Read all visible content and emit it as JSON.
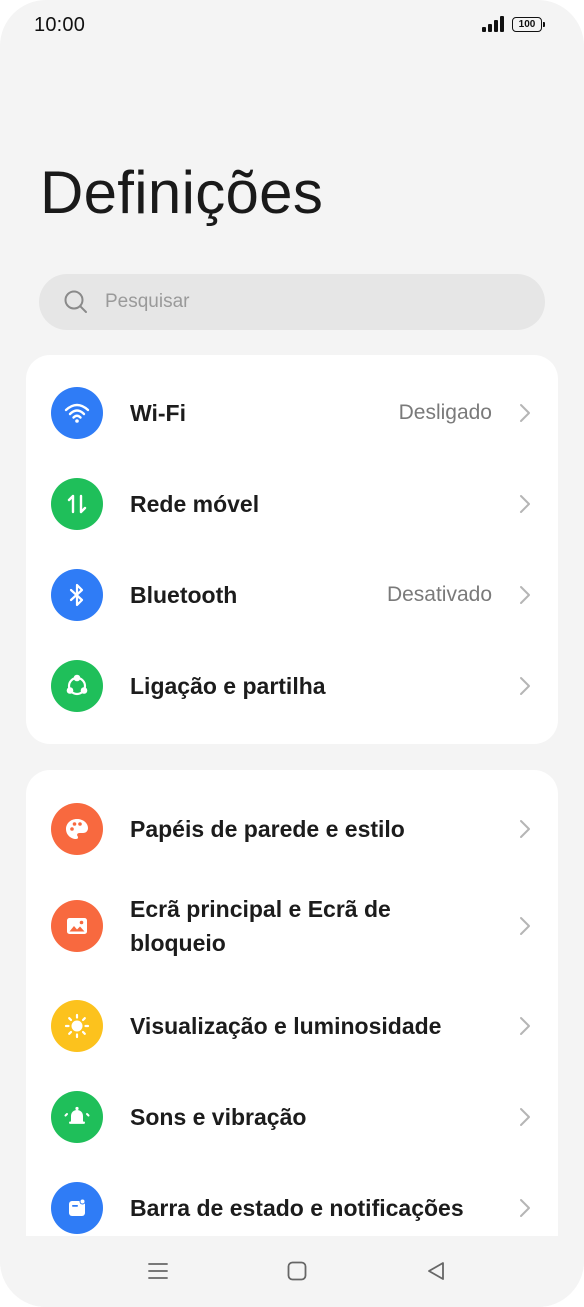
{
  "status_bar": {
    "time": "10:00",
    "battery": "100"
  },
  "page_title": "Definições",
  "search": {
    "placeholder": "Pesquisar"
  },
  "groups": [
    {
      "items": [
        {
          "label": "Wi-Fi",
          "value": "Desligado",
          "icon": "wifi-icon",
          "color": "#2f7cf6"
        },
        {
          "label": "Rede móvel",
          "value": "",
          "icon": "mobile-data-icon",
          "color": "#1fbf5a"
        },
        {
          "label": "Bluetooth",
          "value": "Desativado",
          "icon": "bluetooth-icon",
          "color": "#2f7cf6"
        },
        {
          "label": "Ligação e partilha",
          "value": "",
          "icon": "share-icon",
          "color": "#1fbf5a"
        }
      ]
    },
    {
      "items": [
        {
          "label": "Papéis de parede e estilo",
          "value": "",
          "icon": "palette-icon",
          "color": "#f8693f"
        },
        {
          "label": "Ecrã principal e Ecrã de bloqueio",
          "value": "",
          "icon": "image-icon",
          "color": "#f8693f"
        },
        {
          "label": "Visualização e luminosidade",
          "value": "",
          "icon": "brightness-icon",
          "color": "#fcc21d"
        },
        {
          "label": "Sons e vibração",
          "value": "",
          "icon": "bell-icon",
          "color": "#1fbf5a"
        },
        {
          "label": "Barra de estado e notificações",
          "value": "",
          "icon": "notification-icon",
          "color": "#2f7cf6"
        }
      ]
    }
  ],
  "nav_bar": {
    "buttons": [
      "menu-icon",
      "home-icon",
      "back-icon"
    ]
  }
}
